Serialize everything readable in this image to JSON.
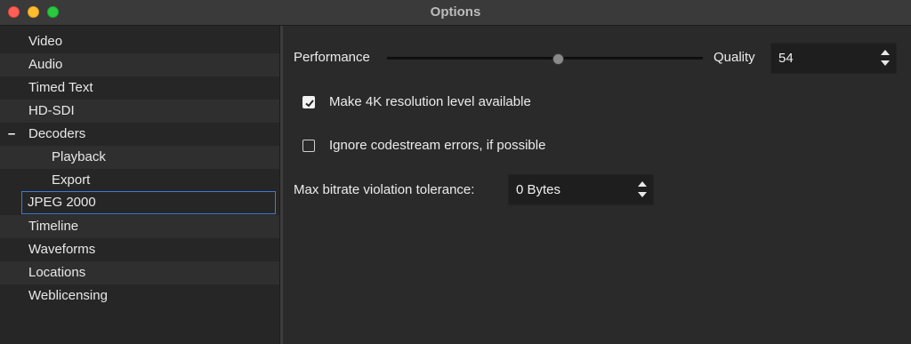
{
  "window": {
    "title": "Options"
  },
  "sidebar": {
    "items": [
      {
        "label": "Video"
      },
      {
        "label": "Audio"
      },
      {
        "label": "Timed Text"
      },
      {
        "label": "HD-SDI"
      },
      {
        "label": "Decoders",
        "expanded_glyph": "–"
      },
      {
        "label": "Playback"
      },
      {
        "label": "Export"
      },
      {
        "label": "JPEG 2000",
        "selected": true
      },
      {
        "label": "Timeline"
      },
      {
        "label": "Waveforms"
      },
      {
        "label": "Locations"
      },
      {
        "label": "Weblicensing"
      }
    ]
  },
  "jpeg2000": {
    "performance_label": "Performance",
    "quality_label": "Quality",
    "quality_value": "54",
    "slider_fraction": 0.54,
    "make4k": {
      "label": "Make 4K resolution level available",
      "checked": true
    },
    "ignore_errors": {
      "label": "Ignore codestream errors, if possible",
      "checked": false
    },
    "bitrate_label": "Max bitrate violation tolerance:",
    "bitrate_value": "0 Bytes"
  }
}
